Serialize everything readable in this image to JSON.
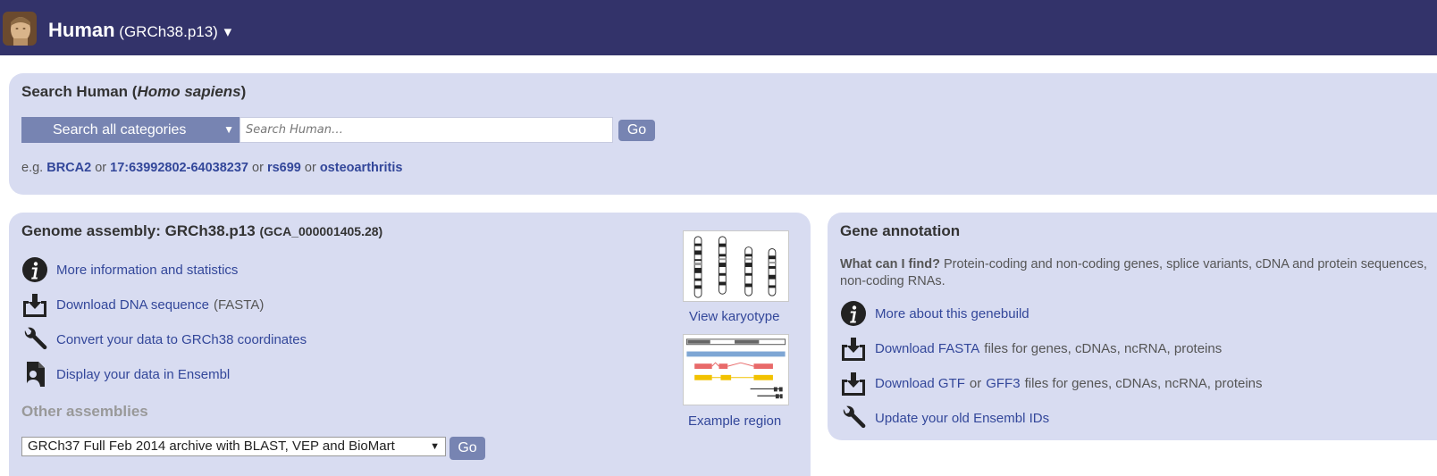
{
  "header": {
    "species_name": "Human",
    "assembly": "(GRCh38.p13)",
    "caret": "▾"
  },
  "search": {
    "title_prefix": "Search Human (",
    "title_species": "Homo sapiens",
    "title_suffix": ")",
    "category_label": "Search all categories",
    "category_arrow": "▼",
    "placeholder": "Search Human…",
    "go_label": "Go",
    "examples_prefix": "e.g.",
    "examples": [
      "BRCA2",
      "17:63992802-64038237",
      "rs699",
      "osteoarthritis"
    ],
    "examples_sep": "or"
  },
  "assembly": {
    "title": "Genome assembly: GRCh38.p13",
    "accession": "(GCA_000001405.28)",
    "links": {
      "more_info": "More information and statistics",
      "download_dna": "Download DNA sequence",
      "download_dna_suffix": "(FASTA)",
      "convert": "Convert your data to GRCh38 coordinates",
      "display": "Display your data in Ensembl"
    },
    "karyotype_label": "View karyotype",
    "region_label": "Example region",
    "other_title": "Other assemblies",
    "other_selected": "GRCh37 Full Feb 2014 archive with BLAST, VEP and BioMart",
    "other_arrow": "▼",
    "go_label": "Go"
  },
  "gene": {
    "title": "Gene annotation",
    "question": "What can I find?",
    "answer": "Protein-coding and non-coding genes, splice variants, cDNA and protein sequences, non-coding RNAs.",
    "more_about": "More about this genebuild",
    "fasta_link": "Download FASTA",
    "fasta_suffix": "files for genes, cDNAs, ncRNA, proteins",
    "gtf_link": "Download GTF",
    "gtf_or": "or",
    "gff3_link": "GFF3",
    "gtf_suffix": "files for genes, cDNAs, ncRNA, proteins",
    "update_ids": "Update your old Ensembl IDs"
  },
  "icons": [
    "info-icon",
    "download-icon",
    "wrench-icon",
    "display-data-icon",
    "species-logo-icon",
    "karyotype-thumbnail",
    "region-thumbnail"
  ],
  "colors": {
    "header_bg": "#33336a",
    "panel_bg": "#d8dcf1",
    "accent": "#7784b2",
    "link": "#33479a"
  }
}
